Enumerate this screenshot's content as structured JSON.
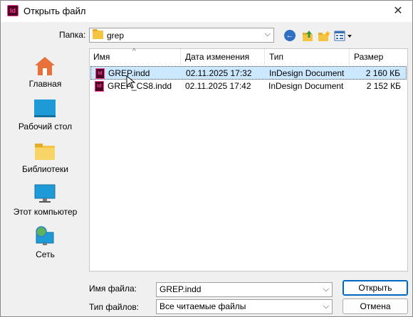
{
  "window": {
    "title": "Открыть файл",
    "close_glyph": "✕"
  },
  "toolbar": {
    "folder_label": "Папка:",
    "folder_value": "grep",
    "back_icon": "back-arrow-icon",
    "up_icon": "folder-up-icon",
    "new_folder_icon": "new-folder-icon",
    "view_icon": "view-menu-icon"
  },
  "places": [
    {
      "label": "Главная",
      "icon": "home-icon"
    },
    {
      "label": "Рабочий стол",
      "icon": "desktop-icon"
    },
    {
      "label": "Библиотеки",
      "icon": "libraries-icon"
    },
    {
      "label": "Этот компьютер",
      "icon": "computer-icon"
    },
    {
      "label": "Сеть",
      "icon": "network-icon"
    }
  ],
  "columns": {
    "name": "Имя",
    "date": "Дата изменения",
    "type": "Тип",
    "size": "Размер"
  },
  "files": [
    {
      "name": "GREP.indd",
      "date": "02.11.2025 17:32",
      "type": "InDesign Document",
      "size": "2 160 КБ",
      "selected": true
    },
    {
      "name": "GREP_CS8.indd",
      "date": "02.11.2025 17:42",
      "type": "InDesign Document",
      "size": "2 152 КБ",
      "selected": false
    }
  ],
  "bottom": {
    "filename_label": "Имя файла:",
    "filename_value": "GREP.indd",
    "filetype_label": "Тип файлов:",
    "filetype_value": "Все читаемые файлы",
    "open_label": "Открыть",
    "cancel_label": "Отмена"
  },
  "colors": {
    "selection": "#cce8ff",
    "accent": "#0067c0",
    "indesign_bg": "#49021f",
    "indesign_fg": "#ff3c9c"
  }
}
